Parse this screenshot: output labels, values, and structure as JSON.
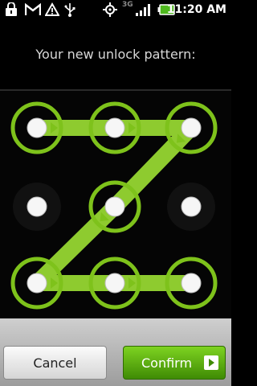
{
  "status_bar": {
    "time": "11:20 AM",
    "network_label": "3G",
    "icons": [
      "lock-icon",
      "gmail-icon",
      "warning-icon",
      "usb-icon",
      "gps-icon",
      "network-3g-icon",
      "signal-icon",
      "battery-icon"
    ]
  },
  "screen": {
    "title": "Your new unlock pattern:"
  },
  "pattern": {
    "grid_size": 3,
    "sequence": [
      0,
      1,
      2,
      4,
      6,
      7,
      8
    ],
    "accent_color": "#7ec21b",
    "line_color": "#8ecb2f"
  },
  "buttons": {
    "cancel_label": "Cancel",
    "confirm_label": "Confirm"
  }
}
